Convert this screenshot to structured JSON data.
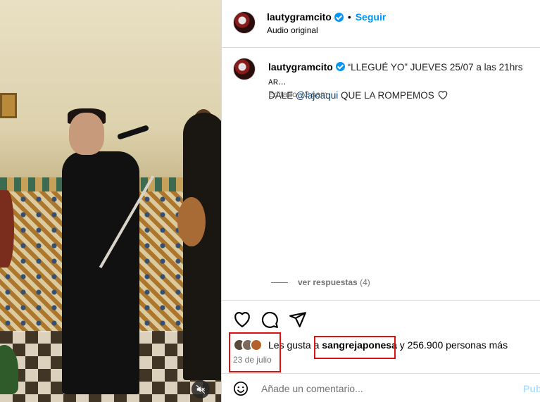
{
  "header": {
    "username": "lautygramcito",
    "separator": "•",
    "follow_label": "Seguir",
    "subtitle": "Audio original"
  },
  "caption": {
    "username": "lautygramcito",
    "text_part1": "“LLEGUÉ YO” JUEVES 25/07 a las 21hrs ᴀʀ...",
    "text_part2": "DALE ",
    "mention": "@lajoaqui",
    "text_part3": " QUE LA ROMPEMOS",
    "edited_label": "Editado",
    "meta_separator": " · ",
    "time_ago": "2 sem"
  },
  "replies": {
    "label": "ver respuestas",
    "count": "(4)"
  },
  "actions": {
    "like": "heart-icon",
    "comment": "comment-icon",
    "share": "share-icon"
  },
  "likes": {
    "prefix": "Les gusta a ",
    "user": "sangrejaponesa",
    "suffix": " y 256.900 personas más"
  },
  "date": "23 de julio",
  "comment_box": {
    "placeholder": "Añade un comentario...",
    "publish_label": "Publicar"
  },
  "media": {
    "mute_icon": "muted-speaker-icon"
  },
  "colors": {
    "accent": "#0095f6",
    "highlight_box": "#e01010",
    "muted_text": "#737373",
    "mention": "#00376b"
  }
}
